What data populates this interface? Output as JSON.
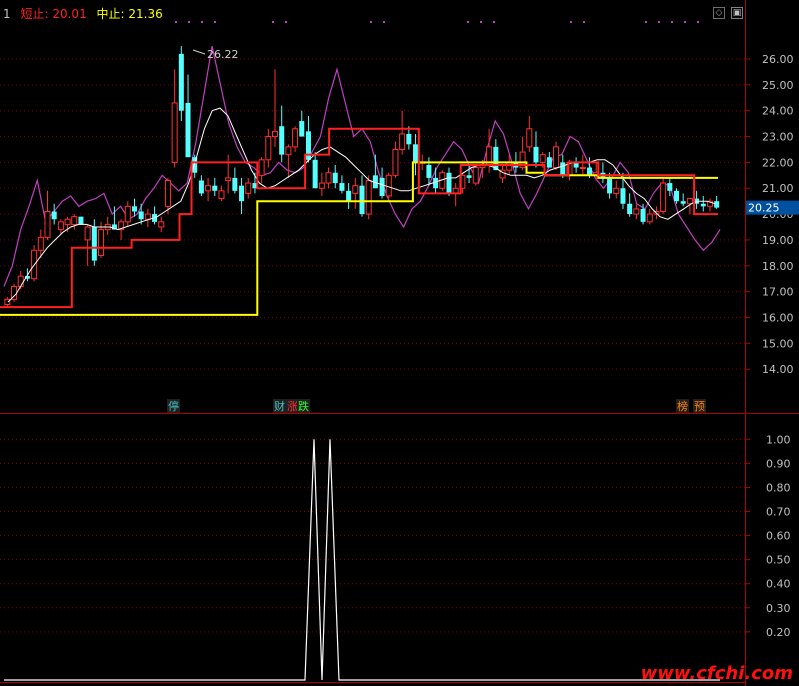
{
  "header": {
    "index": "1",
    "short_stop_label": "短止",
    "short_stop_value": "20.01",
    "mid_stop_label": "中止",
    "mid_stop_value": "21.36"
  },
  "controls": {
    "restore_icon": "diamond-icon",
    "close_icon": "window-close-icon"
  },
  "current_price": "20.25",
  "peak_label": "26.22",
  "event_markers": [
    {
      "text": "停",
      "color": "#40c0c0"
    },
    {
      "text": "财",
      "color": "#40c0c0"
    },
    {
      "text": "涨",
      "color": "#ff3030"
    },
    {
      "text": "跌",
      "color": "#30ff30"
    },
    {
      "text": "榜",
      "color": "#ff8000"
    },
    {
      "text": "预",
      "color": "#ff8000"
    }
  ],
  "watermark": "www.cfchi.com",
  "colors": {
    "background": "#000000",
    "up_candle": "#ff3030",
    "down_candle": "#54ffff",
    "short_stop": "#ff2020",
    "mid_stop": "#ffff00",
    "upper_band": "#c040c0",
    "ma": "#ffffff",
    "grid": "#800000",
    "axis_text": "#c0c0c0"
  },
  "chart_data": [
    {
      "type": "candlestick",
      "yticks": [
        "14.00",
        "15.00",
        "16.00",
        "17.00",
        "18.00",
        "19.00",
        "20.00",
        "21.00",
        "22.00",
        "23.00",
        "24.00",
        "25.00",
        "26.00"
      ],
      "ylim": [
        13.0,
        27.2
      ],
      "current_price": 20.25,
      "candles": [
        [
          16.5,
          16.8,
          16.4,
          16.7
        ],
        [
          16.7,
          17.3,
          16.6,
          17.2
        ],
        [
          17.2,
          17.8,
          17.1,
          17.6
        ],
        [
          17.6,
          17.9,
          17.4,
          17.5
        ],
        [
          17.5,
          18.8,
          17.4,
          18.6
        ],
        [
          18.6,
          19.4,
          18.3,
          19.1
        ],
        [
          19.1,
          20.9,
          19.0,
          20.1
        ],
        [
          20.1,
          20.4,
          19.6,
          19.8
        ],
        [
          19.4,
          19.8,
          19.2,
          19.7
        ],
        [
          19.6,
          19.9,
          19.3,
          19.8
        ],
        [
          19.6,
          20.0,
          19.4,
          19.9
        ],
        [
          19.9,
          19.9,
          19.6,
          19.6
        ],
        [
          19.0,
          19.6,
          18.0,
          19.5
        ],
        [
          19.5,
          19.8,
          18.0,
          18.2
        ],
        [
          18.4,
          19.7,
          18.3,
          19.4
        ],
        [
          19.4,
          19.9,
          19.2,
          19.6
        ],
        [
          19.6,
          20.3,
          19.4,
          19.4
        ],
        [
          19.4,
          19.8,
          19.0,
          19.7
        ],
        [
          19.7,
          20.5,
          19.5,
          20.3
        ],
        [
          20.3,
          20.6,
          19.9,
          20.1
        ],
        [
          20.1,
          20.4,
          19.6,
          19.8
        ],
        [
          19.8,
          20.2,
          19.5,
          20.0
        ],
        [
          20.0,
          20.3,
          19.6,
          19.7
        ],
        [
          19.5,
          19.9,
          19.3,
          19.7
        ],
        [
          20.3,
          21.4,
          20.0,
          21.3
        ],
        [
          22.0,
          25.6,
          21.8,
          24.3
        ],
        [
          26.2,
          26.5,
          23.6,
          24.0
        ],
        [
          24.3,
          25.4,
          23.1,
          22.2
        ],
        [
          22.2,
          22.3,
          21.4,
          21.6
        ],
        [
          21.3,
          21.5,
          20.7,
          20.8
        ],
        [
          20.9,
          21.4,
          20.5,
          21.1
        ],
        [
          21.1,
          21.4,
          20.7,
          20.9
        ],
        [
          20.6,
          21.1,
          20.5,
          20.9
        ],
        [
          21.3,
          22.3,
          20.8,
          21.4
        ],
        [
          21.4,
          21.8,
          20.8,
          20.9
        ],
        [
          21.1,
          21.4,
          20.0,
          20.5
        ],
        [
          20.8,
          21.4,
          20.6,
          21.2
        ],
        [
          21.2,
          21.6,
          20.8,
          21.0
        ],
        [
          21.5,
          22.2,
          21.2,
          22.1
        ],
        [
          22.1,
          23.3,
          21.8,
          23.0
        ],
        [
          23.0,
          25.6,
          22.6,
          23.2
        ],
        [
          23.4,
          24.2,
          22.0,
          22.3
        ],
        [
          22.3,
          22.7,
          21.4,
          22.6
        ],
        [
          22.6,
          23.4,
          22.4,
          23.3
        ],
        [
          23.6,
          24.0,
          23.0,
          23.0
        ],
        [
          23.2,
          23.8,
          22.0,
          22.1
        ],
        [
          22.1,
          22.4,
          21.0,
          21.0
        ],
        [
          21.0,
          21.6,
          20.7,
          21.2
        ],
        [
          21.2,
          21.8,
          21.0,
          21.6
        ],
        [
          21.6,
          21.9,
          21.0,
          21.2
        ],
        [
          21.2,
          21.5,
          20.8,
          20.9
        ],
        [
          20.9,
          21.2,
          20.2,
          20.5
        ],
        [
          20.8,
          21.4,
          20.2,
          21.1
        ],
        [
          21.1,
          21.5,
          19.9,
          20.0
        ],
        [
          20.0,
          21.5,
          19.8,
          21.3
        ],
        [
          21.5,
          22.3,
          21.0,
          21.0
        ],
        [
          21.4,
          21.8,
          20.6,
          20.7
        ],
        [
          20.7,
          21.6,
          20.6,
          21.5
        ],
        [
          21.5,
          22.8,
          21.4,
          22.5
        ],
        [
          22.5,
          24.0,
          22.3,
          23.1
        ],
        [
          23.1,
          23.4,
          22.5,
          22.7
        ],
        [
          22.7,
          23.1,
          21.5,
          22.0
        ],
        [
          22.0,
          22.3,
          21.7,
          22.0
        ],
        [
          21.9,
          22.2,
          21.1,
          21.4
        ],
        [
          21.4,
          21.8,
          20.8,
          21.0
        ],
        [
          21.0,
          21.7,
          20.9,
          21.6
        ],
        [
          21.6,
          21.8,
          20.7,
          20.8
        ],
        [
          20.8,
          21.2,
          20.3,
          21.0
        ],
        [
          21.0,
          21.6,
          20.8,
          21.5
        ],
        [
          21.5,
          21.9,
          21.2,
          21.4
        ],
        [
          21.2,
          21.9,
          21.1,
          21.8
        ],
        [
          21.8,
          22.1,
          21.4,
          21.9
        ],
        [
          21.9,
          23.3,
          21.6,
          22.6
        ],
        [
          22.6,
          22.9,
          21.7,
          21.7
        ],
        [
          21.4,
          21.9,
          21.2,
          21.7
        ],
        [
          21.7,
          22.3,
          21.5,
          22.0
        ],
        [
          22.0,
          22.4,
          21.6,
          21.8
        ],
        [
          21.8,
          23.0,
          21.7,
          22.4
        ],
        [
          22.6,
          23.8,
          22.4,
          23.3
        ],
        [
          22.6,
          23.2,
          21.8,
          22.0
        ],
        [
          22.0,
          22.4,
          21.8,
          22.3
        ],
        [
          22.2,
          22.4,
          21.8,
          21.8
        ],
        [
          21.8,
          22.8,
          21.7,
          22.6
        ],
        [
          22.0,
          22.3,
          21.4,
          21.5
        ],
        [
          21.5,
          22.1,
          21.3,
          22.0
        ],
        [
          22.0,
          22.2,
          21.6,
          21.8
        ],
        [
          21.8,
          22.3,
          21.5,
          21.8
        ],
        [
          21.8,
          22.2,
          21.4,
          21.5
        ],
        [
          21.5,
          22.0,
          21.3,
          21.6
        ],
        [
          21.6,
          22.0,
          21.2,
          21.4
        ],
        [
          21.4,
          21.6,
          20.6,
          20.8
        ],
        [
          20.8,
          21.3,
          20.6,
          21.0
        ],
        [
          21.0,
          21.6,
          20.2,
          20.4
        ],
        [
          20.4,
          20.8,
          19.9,
          20.0
        ],
        [
          20.0,
          20.4,
          19.8,
          20.2
        ],
        [
          20.2,
          20.4,
          19.6,
          19.7
        ],
        [
          19.7,
          20.2,
          19.6,
          20.0
        ],
        [
          20.0,
          20.3,
          19.8,
          20.1
        ],
        [
          20.1,
          21.4,
          20.0,
          21.2
        ],
        [
          21.2,
          21.4,
          20.7,
          20.9
        ],
        [
          20.9,
          21.0,
          20.4,
          20.5
        ],
        [
          20.5,
          20.8,
          20.3,
          20.4
        ],
        [
          20.4,
          20.6,
          20.0,
          20.6
        ],
        [
          20.6,
          20.9,
          20.2,
          20.4
        ],
        [
          20.4,
          20.7,
          20.1,
          20.3
        ],
        [
          20.3,
          20.6,
          20.1,
          20.5
        ],
        [
          20.5,
          20.7,
          20.2,
          20.25
        ]
      ],
      "short_stop": [
        16.4,
        16.4,
        16.4,
        16.4,
        16.4,
        16.4,
        16.4,
        16.4,
        16.4,
        16.4,
        16.4,
        16.4,
        18.7,
        18.7,
        18.7,
        18.7,
        18.7,
        18.7,
        18.7,
        18.7,
        18.7,
        18.7,
        19.0,
        19.0,
        19.0,
        19.0,
        19.0,
        19.0,
        19.0,
        19.0,
        20.0,
        20.0,
        22.0,
        22.0,
        22.0,
        22.0,
        22.0,
        22.0,
        22.0,
        22.0,
        22.0,
        22.0,
        22.0,
        21.0,
        21.0,
        21.0,
        21.0,
        21.0,
        21.0,
        21.0,
        21.0,
        22.3,
        22.3,
        22.3,
        22.3,
        23.3,
        23.3,
        23.3,
        23.3,
        23.3,
        23.3,
        23.3,
        23.3,
        23.3,
        23.3,
        23.3,
        23.3,
        23.3,
        23.3,
        23.3,
        20.8,
        20.8,
        20.8,
        20.8,
        20.8,
        20.8,
        20.8,
        21.9,
        21.9,
        21.9,
        21.9,
        21.9,
        21.9,
        21.9,
        21.9,
        21.9,
        21.9,
        21.9,
        21.9,
        21.9,
        21.9,
        21.5,
        21.5,
        21.5,
        21.5,
        22.0,
        22.0,
        22.0,
        22.0,
        22.0,
        21.5,
        21.5,
        21.5,
        21.5,
        21.5,
        21.5,
        21.5,
        21.5,
        21.5,
        21.5,
        21.5,
        21.5,
        21.5,
        21.5,
        21.5,
        21.5,
        20.0,
        20.0,
        20.0,
        20.0
      ],
      "mid_stop": [
        16.1,
        16.1,
        16.1,
        16.1,
        16.1,
        16.1,
        16.1,
        16.1,
        16.1,
        16.1,
        16.1,
        16.1,
        16.1,
        16.1,
        16.1,
        16.1,
        16.1,
        16.1,
        16.1,
        16.1,
        16.1,
        16.1,
        16.1,
        16.1,
        16.1,
        16.1,
        16.1,
        16.1,
        16.1,
        16.1,
        16.1,
        16.1,
        16.1,
        16.1,
        16.1,
        16.1,
        16.1,
        16.1,
        16.1,
        16.1,
        16.1,
        16.1,
        16.1,
        20.5,
        20.5,
        20.5,
        20.5,
        20.5,
        20.5,
        20.5,
        20.5,
        20.5,
        20.5,
        20.5,
        20.5,
        20.5,
        20.5,
        20.5,
        20.5,
        20.5,
        20.5,
        20.5,
        20.5,
        20.5,
        20.5,
        20.5,
        20.5,
        20.5,
        20.5,
        22.0,
        22.0,
        22.0,
        22.0,
        22.0,
        22.0,
        22.0,
        22.0,
        22.0,
        22.0,
        22.0,
        22.0,
        22.0,
        22.0,
        22.0,
        22.0,
        22.0,
        22.0,
        22.0,
        21.6,
        21.6,
        21.6,
        21.5,
        21.5,
        21.5,
        21.5,
        21.5,
        21.5,
        21.5,
        21.5,
        21.5,
        21.4,
        21.4,
        21.4,
        21.4,
        21.4,
        21.4,
        21.4,
        21.4,
        21.4,
        21.4,
        21.4,
        21.4,
        21.4,
        21.4,
        21.4,
        21.4,
        21.4,
        21.4,
        21.4,
        21.4
      ],
      "upper_band": [
        17.2,
        18.0,
        19.4,
        20.3,
        21.3,
        19.7,
        20.1,
        20.5,
        20.7,
        20.3,
        20.5,
        20.6,
        20.8,
        20.0,
        20.3,
        19.8,
        20.0,
        20.6,
        21.0,
        21.5,
        21.2,
        20.9,
        21.2,
        22.7,
        24.6,
        26.5,
        25.0,
        23.5,
        22.6,
        22.0,
        21.8,
        21.5,
        21.6,
        22.0,
        21.7,
        21.6,
        21.8,
        22.4,
        23.0,
        24.5,
        25.6,
        24.3,
        23.0,
        23.3,
        22.8,
        21.6,
        20.7,
        20.0,
        19.5,
        20.2,
        20.5,
        21.1,
        21.8,
        22.3,
        22.8,
        22.5,
        21.8,
        21.2,
        22.5,
        23.6,
        23.1,
        22.0,
        20.8,
        20.2,
        20.8,
        21.5,
        22.2,
        22.3,
        23.0,
        22.8,
        22.1,
        21.4,
        21.0,
        21.4,
        22.0,
        21.6,
        20.4,
        20.2,
        20.8,
        21.2,
        21.1,
        20.0,
        19.5,
        19.0,
        18.6,
        18.9,
        19.4
      ],
      "ma": [
        16.6,
        16.9,
        17.4,
        17.9,
        18.3,
        18.7,
        19.0,
        19.3,
        19.5,
        19.6,
        19.6,
        19.5,
        19.5,
        19.5,
        19.4,
        19.5,
        19.6,
        19.7,
        19.8,
        19.9,
        20.1,
        20.3,
        20.5,
        21.2,
        22.2,
        23.3,
        24.0,
        24.1,
        23.8,
        23.1,
        22.4,
        21.7,
        21.2,
        21.0,
        21.1,
        21.3,
        21.5,
        21.7,
        22.0,
        22.3,
        22.5,
        22.6,
        22.4,
        22.2,
        21.9,
        21.6,
        21.3,
        21.2,
        21.1,
        21.0,
        20.9,
        20.9,
        21.0,
        21.1,
        21.2,
        21.3,
        21.4,
        21.4,
        21.6,
        21.8,
        21.9,
        21.9,
        21.8,
        21.6,
        21.5,
        21.5,
        21.5,
        21.4,
        21.5,
        21.7,
        21.8,
        21.9,
        22.0,
        22.0,
        22.0,
        22.1,
        22.1,
        21.9,
        21.5,
        21.1,
        20.8,
        20.6,
        20.2,
        19.9,
        19.8,
        20.0,
        20.2,
        20.4,
        20.5,
        20.5,
        20.4
      ]
    },
    {
      "type": "line",
      "yticks": [
        "0.20",
        "0.30",
        "0.40",
        "0.50",
        "0.60",
        "0.70",
        "0.80",
        "0.90",
        "1.00"
      ],
      "ylim": [
        0.0,
        1.08
      ],
      "x_count": 110,
      "values_nonzero": [
        [
          52,
          0
        ],
        [
          53,
          1.0
        ],
        [
          54,
          0
        ],
        [
          55,
          1.0
        ],
        [
          56,
          0
        ]
      ]
    }
  ]
}
